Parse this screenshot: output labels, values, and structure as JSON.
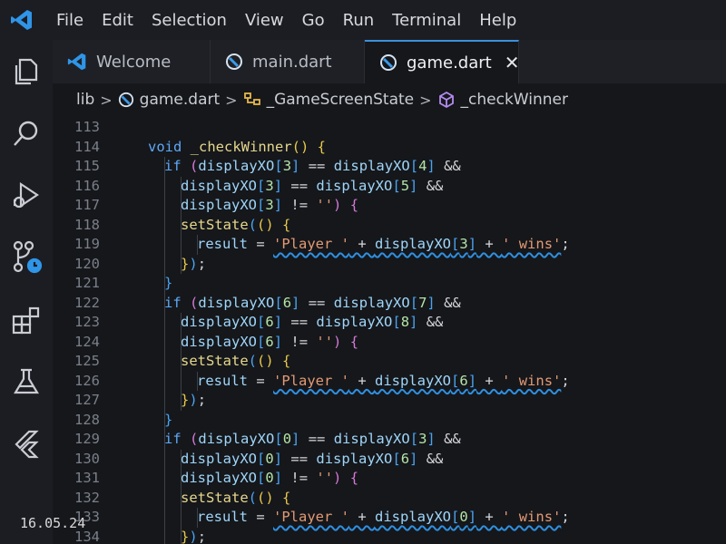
{
  "menu": [
    "File",
    "Edit",
    "Selection",
    "View",
    "Go",
    "Run",
    "Terminal",
    "Help"
  ],
  "tabs": [
    {
      "label": "Welcome",
      "icon": "vscode-logo-icon",
      "active": false
    },
    {
      "label": "main.dart",
      "icon": "dart-file-icon",
      "active": false
    },
    {
      "label": "game.dart",
      "icon": "dart-file-icon",
      "active": true,
      "close": "✕"
    }
  ],
  "breadcrumb": {
    "folder": "lib",
    "file": "game.dart",
    "class": "_GameScreenState",
    "method": "_checkWinner",
    "separator": ">"
  },
  "activity_icons": [
    "explorer-icon",
    "search-icon",
    "run-debug-icon",
    "source-control-icon",
    "extensions-icon",
    "testing-icon",
    "flutter-icon"
  ],
  "editor": {
    "lines": [
      {
        "n": "113",
        "indent": 0,
        "tokens": []
      },
      {
        "n": "114",
        "indent": 0,
        "tokens": [
          [
            "kw",
            "void"
          ],
          [
            "t",
            " "
          ],
          [
            "fn",
            "_checkWinner"
          ],
          [
            "br",
            "()"
          ],
          [
            "t",
            " "
          ],
          [
            "br",
            "{"
          ]
        ]
      },
      {
        "n": "115",
        "indent": 1,
        "tokens": [
          [
            "kw",
            "if"
          ],
          [
            "t",
            " "
          ],
          [
            "br2",
            "("
          ],
          [
            "id",
            "displayXO"
          ],
          [
            "br3",
            "["
          ],
          [
            "num",
            "3"
          ],
          [
            "br3",
            "]"
          ],
          [
            "t",
            " == "
          ],
          [
            "id",
            "displayXO"
          ],
          [
            "br3",
            "["
          ],
          [
            "num",
            "4"
          ],
          [
            "br3",
            "]"
          ],
          [
            "t",
            " &&"
          ]
        ]
      },
      {
        "n": "116",
        "indent": 2,
        "tokens": [
          [
            "id",
            "displayXO"
          ],
          [
            "br3",
            "["
          ],
          [
            "num",
            "3"
          ],
          [
            "br3",
            "]"
          ],
          [
            "t",
            " == "
          ],
          [
            "id",
            "displayXO"
          ],
          [
            "br3",
            "["
          ],
          [
            "num",
            "5"
          ],
          [
            "br3",
            "]"
          ],
          [
            "t",
            " &&"
          ]
        ]
      },
      {
        "n": "117",
        "indent": 2,
        "tokens": [
          [
            "id",
            "displayXO"
          ],
          [
            "br3",
            "["
          ],
          [
            "num",
            "3"
          ],
          [
            "br3",
            "]"
          ],
          [
            "t",
            " != "
          ],
          [
            "str",
            "''"
          ],
          [
            "br2",
            ")"
          ],
          [
            "t",
            " "
          ],
          [
            "br2",
            "{"
          ]
        ]
      },
      {
        "n": "118",
        "indent": 2,
        "tokens": [
          [
            "fn",
            "setState"
          ],
          [
            "br3",
            "("
          ],
          [
            "br",
            "()"
          ],
          [
            "t",
            " "
          ],
          [
            "br",
            "{"
          ]
        ]
      },
      {
        "n": "119",
        "indent": 3,
        "tokens": [
          [
            "id",
            "result"
          ],
          [
            "t",
            " = "
          ],
          [
            "sq",
            "'Player ' + displayXO[3] + ' wins'"
          ],
          [
            "t",
            ";"
          ]
        ]
      },
      {
        "n": "120",
        "indent": 2,
        "tokens": [
          [
            "br",
            "}"
          ],
          [
            "br3",
            ")"
          ],
          [
            "t",
            ";"
          ]
        ]
      },
      {
        "n": "121",
        "indent": 1,
        "tokens": [
          [
            "br3",
            "}"
          ]
        ]
      },
      {
        "n": "122",
        "indent": 1,
        "tokens": [
          [
            "kw",
            "if"
          ],
          [
            "t",
            " "
          ],
          [
            "br2",
            "("
          ],
          [
            "id",
            "displayXO"
          ],
          [
            "br3",
            "["
          ],
          [
            "num",
            "6"
          ],
          [
            "br3",
            "]"
          ],
          [
            "t",
            " == "
          ],
          [
            "id",
            "displayXO"
          ],
          [
            "br3",
            "["
          ],
          [
            "num",
            "7"
          ],
          [
            "br3",
            "]"
          ],
          [
            "t",
            " &&"
          ]
        ]
      },
      {
        "n": "123",
        "indent": 2,
        "tokens": [
          [
            "id",
            "displayXO"
          ],
          [
            "br3",
            "["
          ],
          [
            "num",
            "6"
          ],
          [
            "br3",
            "]"
          ],
          [
            "t",
            " == "
          ],
          [
            "id",
            "displayXO"
          ],
          [
            "br3",
            "["
          ],
          [
            "num",
            "8"
          ],
          [
            "br3",
            "]"
          ],
          [
            "t",
            " &&"
          ]
        ]
      },
      {
        "n": "124",
        "indent": 2,
        "tokens": [
          [
            "id",
            "displayXO"
          ],
          [
            "br3",
            "["
          ],
          [
            "num",
            "6"
          ],
          [
            "br3",
            "]"
          ],
          [
            "t",
            " != "
          ],
          [
            "str",
            "''"
          ],
          [
            "br2",
            ")"
          ],
          [
            "t",
            " "
          ],
          [
            "br2",
            "{"
          ]
        ]
      },
      {
        "n": "125",
        "indent": 2,
        "tokens": [
          [
            "fn",
            "setState"
          ],
          [
            "br3",
            "("
          ],
          [
            "br",
            "()"
          ],
          [
            "t",
            " "
          ],
          [
            "br",
            "{"
          ]
        ]
      },
      {
        "n": "126",
        "indent": 3,
        "tokens": [
          [
            "id",
            "result"
          ],
          [
            "t",
            " = "
          ],
          [
            "sq",
            "'Player ' + displayXO[6] + ' wins'"
          ],
          [
            "t",
            ";"
          ]
        ]
      },
      {
        "n": "127",
        "indent": 2,
        "tokens": [
          [
            "br",
            "}"
          ],
          [
            "br3",
            ")"
          ],
          [
            "t",
            ";"
          ]
        ]
      },
      {
        "n": "128",
        "indent": 1,
        "tokens": [
          [
            "br3",
            "}"
          ]
        ]
      },
      {
        "n": "129",
        "indent": 1,
        "tokens": [
          [
            "kw",
            "if"
          ],
          [
            "t",
            " "
          ],
          [
            "br2",
            "("
          ],
          [
            "id",
            "displayXO"
          ],
          [
            "br3",
            "["
          ],
          [
            "num",
            "0"
          ],
          [
            "br3",
            "]"
          ],
          [
            "t",
            " == "
          ],
          [
            "id",
            "displayXO"
          ],
          [
            "br3",
            "["
          ],
          [
            "num",
            "3"
          ],
          [
            "br3",
            "]"
          ],
          [
            "t",
            " &&"
          ]
        ]
      },
      {
        "n": "130",
        "indent": 2,
        "tokens": [
          [
            "id",
            "displayXO"
          ],
          [
            "br3",
            "["
          ],
          [
            "num",
            "0"
          ],
          [
            "br3",
            "]"
          ],
          [
            "t",
            " == "
          ],
          [
            "id",
            "displayXO"
          ],
          [
            "br3",
            "["
          ],
          [
            "num",
            "6"
          ],
          [
            "br3",
            "]"
          ],
          [
            "t",
            " &&"
          ]
        ]
      },
      {
        "n": "131",
        "indent": 2,
        "tokens": [
          [
            "id",
            "displayXO"
          ],
          [
            "br3",
            "["
          ],
          [
            "num",
            "0"
          ],
          [
            "br3",
            "]"
          ],
          [
            "t",
            " != "
          ],
          [
            "str",
            "''"
          ],
          [
            "br2",
            ")"
          ],
          [
            "t",
            " "
          ],
          [
            "br2",
            "{"
          ]
        ]
      },
      {
        "n": "132",
        "indent": 2,
        "tokens": [
          [
            "fn",
            "setState"
          ],
          [
            "br3",
            "("
          ],
          [
            "br",
            "()"
          ],
          [
            "t",
            " "
          ],
          [
            "br",
            "{"
          ]
        ]
      },
      {
        "n": "133",
        "indent": 3,
        "tokens": [
          [
            "id",
            "result"
          ],
          [
            "t",
            " = "
          ],
          [
            "sq",
            "'Player ' + displayXO[0] + ' wins'"
          ],
          [
            "t",
            ";"
          ]
        ]
      },
      {
        "n": "134",
        "indent": 2,
        "tokens": [
          [
            "br",
            "}"
          ],
          [
            "br3",
            ")"
          ],
          [
            "t",
            ";"
          ]
        ]
      }
    ]
  },
  "photo_timestamp": "16.05.24",
  "colors": {
    "accent": "#3c8fdc",
    "keyword": "#5ea8f5",
    "function": "#e6d78c",
    "identifier": "#9fd5f8",
    "string": "#e39a74",
    "number": "#b5e3a8"
  }
}
